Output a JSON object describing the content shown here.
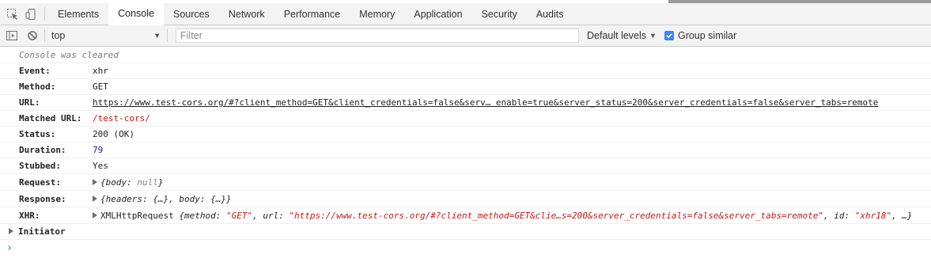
{
  "tabs": [
    "Elements",
    "Console",
    "Sources",
    "Network",
    "Performance",
    "Memory",
    "Application",
    "Security",
    "Audits"
  ],
  "active_tab": "Console",
  "toolbar": {
    "context": "top",
    "filter_placeholder": "Filter",
    "levels": "Default levels",
    "group_similar": "Group similar",
    "group_similar_checked": true
  },
  "console": {
    "cleared": "Console was cleared",
    "rows": [
      {
        "key": "Event:",
        "value": "xhr"
      },
      {
        "key": "Method:",
        "value": "GET"
      },
      {
        "key": "URL:",
        "value": "https://www.test-cors.org/#?client_method=GET&client_credentials=false&serv… enable=true&server_status=200&server_credentials=false&server_tabs=remote"
      },
      {
        "key": "Matched URL:",
        "value": "/test-cors/"
      },
      {
        "key": "Status:",
        "value": "200 (OK)"
      },
      {
        "key": "Duration:",
        "value": "79"
      },
      {
        "key": "Stubbed:",
        "value": "Yes"
      },
      {
        "key": "Request:",
        "value": "{body: null}"
      },
      {
        "key": "Response:",
        "value": "{headers: {…}, body: {…}}"
      },
      {
        "key": "XHR:",
        "value": "XMLHttpRequest {method: \"GET\", url: \"https://www.test-cors.org/#?client_method=GET&clie…s=200&server_credentials=false&server_tabs=remote\", id: \"xhr18\", …}"
      }
    ],
    "request_parts": {
      "open": "{body: ",
      "null": "null",
      "close": "}"
    },
    "response_parts": {
      "text": "{headers: {…}, body: {…}}"
    },
    "xhr_parts": {
      "type": "XMLHttpRequest ",
      "open": "{method: ",
      "method": "\"GET\"",
      "url_key": ", url: ",
      "url": "\"https://www.test-cors.org/#?client_method=GET&clie…s=200&server_credentials=false&server_tabs=remote\"",
      "id_key": ", id: ",
      "id": "\"xhr18\"",
      "close": ", …}"
    },
    "initiator": "Initiator",
    "prompt": "›"
  }
}
